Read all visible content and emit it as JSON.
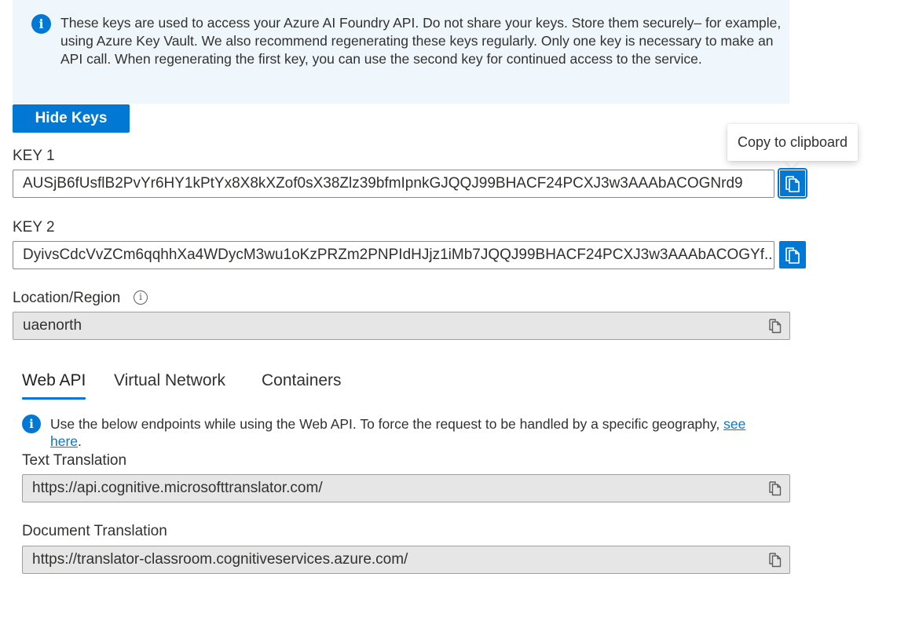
{
  "info_banner": {
    "icon": "info-icon",
    "text": "These keys are used to access your Azure AI Foundry API. Do not share your keys. Store them securely– for example, using Azure Key Vault. We also recommend regenerating these keys regularly. Only one key is necessary to make an API call. When regenerating the first key, you can use the second key for continued access to the service."
  },
  "hide_keys_button": "Hide Keys",
  "key1": {
    "label": "KEY 1",
    "value": "AUSjB6fUsflB2PvYr6HY1kPtYx8X8kXZof0sX38Zlz39bfmIpnkGJQQJ99BHACF24PCXJ3w3AAAbACOGNrd9"
  },
  "key2": {
    "label": "KEY 2",
    "value": "DyivsCdcVvZCm6qqhhXa4WDycM3wu1oKzPRZm2PNPIdHJjz1iMb7JQQJ99BHACF24PCXJ3w3AAAbACOGYf..."
  },
  "tooltip": "Copy to clipboard",
  "location": {
    "label": "Location/Region",
    "value": "uaenorth"
  },
  "tabs": [
    {
      "label": "Web API",
      "active": true
    },
    {
      "label": "Virtual Network",
      "active": false
    },
    {
      "label": "Containers",
      "active": false
    }
  ],
  "web_api_note": {
    "text": "Use the below endpoints while using the Web API. To force the request to be handled by a specific geography,",
    "link": "see here",
    "suffix": "."
  },
  "text_translation": {
    "label": "Text Translation",
    "value": "https://api.cognitive.microsofttranslator.com/"
  },
  "document_translation": {
    "label": "Document Translation",
    "value": "https://translator-classroom.cognitiveservices.azure.com/"
  },
  "colors": {
    "accent": "#0078d4",
    "banner_background": "#eff6fc",
    "readonly_field_background": "#e6e6e6"
  }
}
